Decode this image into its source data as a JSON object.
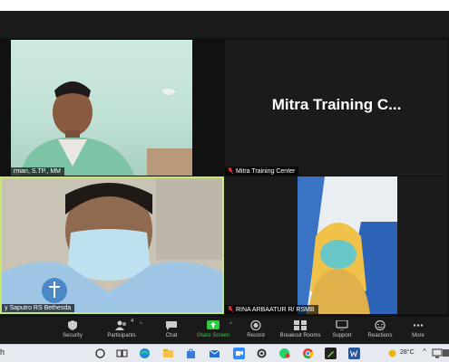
{
  "participants": [
    {
      "name": "rman, S.TP., MM"
    },
    {
      "name": "Mitra Training Center",
      "display": "Mitra Training C..."
    },
    {
      "name": "y Saputro RS Bethesda"
    },
    {
      "name": "RINA ARBAATUR R/ RSMB"
    }
  ],
  "toolbar": {
    "security": "Security",
    "participants": "Participants",
    "participants_count": "4",
    "chat": "Chat",
    "share_screen": "Share Screen",
    "record": "Record",
    "breakout_rooms": "Breakout Rooms",
    "support": "Support",
    "reactions": "Reactions",
    "more": "More"
  },
  "colors": {
    "active_speaker_border": "#c7e86c",
    "share_screen_green": "#2ecc40"
  },
  "taskbar": {
    "search_fragment": "h",
    "temperature": "28°C",
    "icons": [
      "circle-icon",
      "task-view-icon",
      "edge-icon",
      "file-explorer-icon",
      "store-icon",
      "mail-icon",
      "zoom-icon",
      "settings-icon",
      "whatsapp-icon",
      "chrome-icon",
      "pen-icon",
      "word-icon",
      "weather-icon",
      "chevron-up-icon",
      "network-icon",
      "notification-icon"
    ]
  }
}
